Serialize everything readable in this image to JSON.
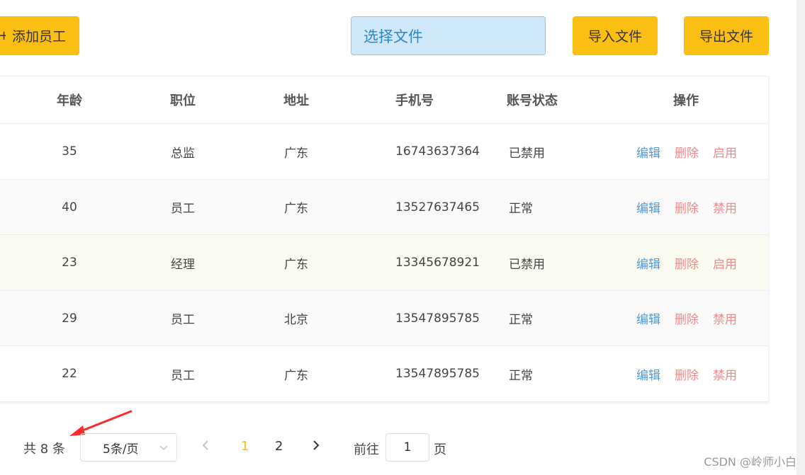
{
  "toolbar": {
    "add_plus": "+",
    "add_label": "添加员工",
    "file_label": "选择文件",
    "import_label": "导入文件",
    "export_label": "导出文件"
  },
  "table": {
    "headers": {
      "age": "年龄",
      "position": "职位",
      "address": "地址",
      "phone": "手机号",
      "status": "账号状态",
      "ops": "操作"
    },
    "rows": [
      {
        "age": "35",
        "position": "总监",
        "address": "广东",
        "phone": "16743637364",
        "status": "已禁用",
        "edit": "编辑",
        "delete": "删除",
        "toggle": "启用"
      },
      {
        "age": "40",
        "position": "员工",
        "address": "广东",
        "phone": "13527637465",
        "status": "正常",
        "edit": "编辑",
        "delete": "删除",
        "toggle": "禁用"
      },
      {
        "age": "23",
        "position": "经理",
        "address": "广东",
        "phone": "13345678921",
        "status": "已禁用",
        "edit": "编辑",
        "delete": "删除",
        "toggle": "启用"
      },
      {
        "age": "29",
        "position": "员工",
        "address": "北京",
        "phone": "13547895785",
        "status": "正常",
        "edit": "编辑",
        "delete": "删除",
        "toggle": "禁用"
      },
      {
        "age": "22",
        "position": "员工",
        "address": "广东",
        "phone": "13547895785",
        "status": "正常",
        "edit": "编辑",
        "delete": "删除",
        "toggle": "禁用"
      }
    ],
    "row_colors": [
      "#ffffff",
      "#fafafa",
      "#fbfbf2",
      "#fafafa",
      "#ffffff"
    ]
  },
  "pagination": {
    "total": "共 8 条",
    "page_size": "5条/页",
    "pages": [
      "1",
      "2"
    ],
    "active_page": "1",
    "goto_label": "前往",
    "goto_value": "1",
    "goto_suffix": "页"
  },
  "annotation": {
    "arrow_color": "#ff2a2a"
  },
  "watermark": "CSDN @岭师小白"
}
